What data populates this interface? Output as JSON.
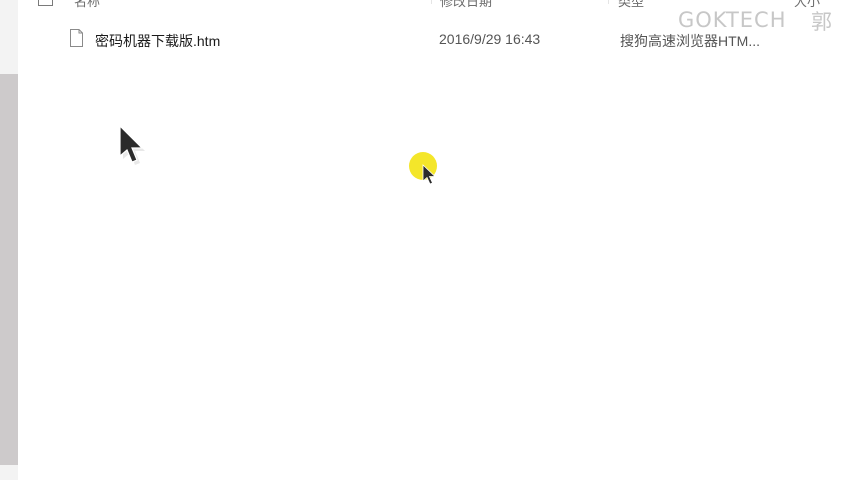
{
  "explorer": {
    "columns": {
      "name": "名称",
      "modified": "修改日期",
      "type": "类型",
      "size": "大小"
    },
    "files": [
      {
        "name": "密码机器下载版.htm",
        "date": "2016/9/29 16:43",
        "type": "搜狗高速浏览器HTM..."
      }
    ]
  },
  "overlay": {
    "watermark": "GOKTECH",
    "watermark_char": "郭"
  },
  "colors": {
    "scrollbar_thumb": "#cdcacb",
    "click_highlight": "#f4e62a",
    "watermark": "#c7c7c7"
  },
  "icons": {
    "file": "file-htm-icon",
    "pointer": "mouse-pointer-icon"
  }
}
